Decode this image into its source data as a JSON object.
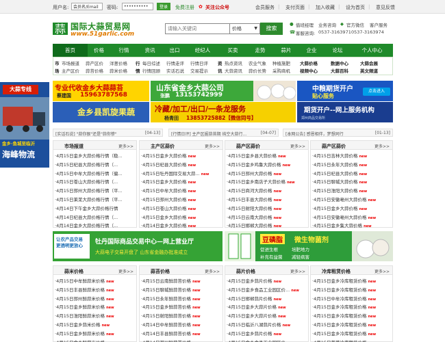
{
  "topbar": {
    "username_label": "用户名:",
    "username_value": "会员名/Email",
    "password_label": "密码:",
    "password_value": "••••••••••",
    "login_button": "登录",
    "register_link": "免费注册",
    "follow_link": "关注公众号",
    "links": [
      "会员服务",
      "支付页面",
      "加入收藏",
      "设为首页",
      "意见反馈"
    ]
  },
  "header": {
    "logo_title": "国际大蒜贸易网",
    "logo_url": "www.51garlic.com",
    "search_placeholder": "请输入关键词",
    "search_select": "价格",
    "search_button": "搜索",
    "contact": {
      "manager": "值班经理",
      "biz": "业务咨询",
      "wechat": "官方微信",
      "cs": "客户服务",
      "hotline": "客服咨询:",
      "phone1": "0537-3163971",
      "phone2": "0537-3163974"
    }
  },
  "nav": [
    "首页",
    "价格",
    "行情",
    "资讯",
    "出口",
    "经纪人",
    "买卖",
    "走势",
    "蒜片",
    "企业",
    "论坛",
    "个人中心"
  ],
  "subnav": {
    "row1": [
      {
        "t": "市",
        "b": true
      },
      "市场报道",
      "蒜产区价",
      "洋葱价格",
      {
        "t": "行",
        "b": true
      },
      "每日综述",
      "行情走评",
      "行情日评",
      {
        "t": "资",
        "b": true
      },
      "热点资讯",
      "农业气象",
      "种植施肥",
      {
        "t": "大蒜价格",
        "b": true
      },
      {
        "t": "数据中心",
        "b": true
      },
      {
        "t": "大蒜会展",
        "b": true
      }
    ],
    "row2": [
      {
        "t": "场",
        "b": true
      },
      "主产区价",
      "蒜苔价格",
      "蒜米价格",
      {
        "t": "情",
        "b": true
      },
      "行情回顾",
      "实话石说",
      "交易提示",
      {
        "t": "讯",
        "b": true
      },
      "大蒜资讯",
      "蒜价长势",
      "采购商机",
      {
        "t": "视频中心",
        "b": true
      },
      {
        "t": "大蒜百科",
        "b": true
      },
      {
        "t": "英文频道",
        "b": true
      }
    ]
  },
  "banners": {
    "b1_line1": "专业代收金乡大蒜蒜苔",
    "b1_name": "蔡建国",
    "b1_phone": "15963787568",
    "b1_line2": "金乡县凯旋果蔬",
    "b2_line1": "山东省金乡大蒜公司",
    "b2_name": "张鹏",
    "b2_phone": "13153742999",
    "b2_line2": "冷藏/加工/出口/一条龙服务",
    "b2_name2": "杨青田",
    "b2_phone2": "13853725882【微信同号】",
    "b3_title": "中粮期货开户",
    "b3_sub": "贴心服务",
    "b3_btn": "点击进入",
    "b4_title": "期货开户--网上服务机构",
    "b4_sub": "郑州商品交易所",
    "float_title": "大蒜专线",
    "float_sub": "金乡·鱼城至临沂",
    "float_brand": "海峰物流",
    "mid1_left": "让农产品交易 更透明更放心",
    "mid1_main": "牡丹国际商品交易中心—网上营业厅",
    "mid1_sub": "大蒜电子交易开盘了 山东省金融办批准成立",
    "mid2_title": "豆磷脂",
    "mid2_title2": "微生物菌剂",
    "mid2_items": [
      "促进生根",
      "培肥地力",
      "补充有益菌",
      "减轻病害"
    ]
  },
  "notices": [
    {
      "text": "[实话石说] \"蒜你狠\"还是\"蒜你惨\"",
      "date": "[04-13]"
    },
    {
      "text": "[行情日评] 主产区掘蒜苔期 纯空大蒜行...",
      "date": "[04-07]"
    },
    {
      "text": "[本网公告] 感恩相伴，梦想同行",
      "date": "[01-13]"
    }
  ],
  "columns1": [
    {
      "title": "市场报道",
      "more": "更多>>",
      "rows": [
        "4月15日金乡大蒜价格行情（稳...",
        "4月15日杞县大蒜价格行情（...",
        "4月15日中牟大蒜价格行情（偏...",
        "4月15日苍山大蒜价格行情（...",
        "4月15日邳州大蒜价格行情（平...",
        "4月15日莱芜大蒜价格行情（平...",
        "4月14日下午金乡大蒜价格行情",
        "4月14日杞县大蒜价格行情（...",
        "4月14日金乡大蒜价格行情（..."
      ]
    },
    {
      "title": "主产区蒜价",
      "more": "更多>>",
      "rows": [
        "4月15日金乡大蒜价格",
        "4月15日杞县大蒜价格",
        "4月15日牡丹国际交易大蒜...",
        "4月15日金乡大蒜价格",
        "4月15日中牟大蒜价格",
        "4月15日邳州大蒜价格",
        "4月15日苍山大蒜价格",
        "4月15日金乡大蒜价格",
        "4月14日金乡大蒜价格"
      ]
    },
    {
      "title": "蒜产区蒜价",
      "more": "更多>>",
      "rows": [
        "4月15日金乡县大蒜价格",
        "4月15日金乡鸡鲁大蒜价格",
        "4月15日邳州大蒜价格",
        "4月15日金乡南店子大蒜价格",
        "4月15日商河大蒜价格",
        "4月15日丰县大蒜价格",
        "4月15日射阳大蒜价格",
        "4月15日云南大蒜价格",
        "4月15日邯郸大蒜价格"
      ]
    },
    {
      "title": "蒜产区蒜价",
      "more": "更多>>",
      "rows": [
        "4月15日吉林大蒜价格",
        "4月15日永年大蒜价格",
        "4月15日杞县大蒜价格",
        "4月15日聊城大蒜价格",
        "4月15日淮阳大蒜价格",
        "4月15日安徽亳州大蒜价格",
        "4月15日金乡大蒜价格",
        "4月15日安徽亳州大蒜价格",
        "4月15日金乡集大蒜价格"
      ]
    }
  ],
  "columns2": [
    {
      "title": "蒜米价格",
      "more": "更多>>",
      "rows": [
        "4月15日中牟鲜蒜米价格",
        "4月15日丰县鲜蒜米价格",
        "4月15日邳州鲜蒜米价格",
        "4月15日金乡鲜蒜米价格",
        "4月15日淮阳鲜蒜米价格",
        "4月15日金乡蒜米价格",
        "4月15日金乡鲜蒜米价格",
        "4月15日金乡鲜蒜米价格",
        "4月15日苍山鲜蒜米价格"
      ]
    },
    {
      "title": "蒜苔价格",
      "more": "更多>>",
      "rows": [
        "4月15日云南鲜蒜苔价格",
        "4月15日聊城鲜蒜苔价格",
        "4月15日永年鲜蒜苔价格",
        "4月15日金乡鲜蒜苔价格",
        "4月15日射阳鲜蒜苔价格",
        "4月14日中牟鲜蒜苔价格",
        "4月14日丰县鲜蒜苔价格",
        "4月14日邳州鲜蒜苔价格",
        "4月14日金乡鲜蒜苔价格"
      ]
    },
    {
      "title": "蒜片价格",
      "more": "更多>>",
      "rows": [
        "4月15日金乡蒜片价格",
        "4月15日金乡食品工业园区价...",
        "4月15日邯郸蒜片价格",
        "4月15日金乡大蒜片价格",
        "4月15日金乡大蒜片价格",
        "4月15日临沂八湖蒜片价格",
        "4月15日金乡蒜片价格",
        "4月15日金乡食品工业园区价...",
        "4月15日金乡蒜片价格"
      ]
    },
    {
      "title": "冷库租赁价格",
      "more": "更多>>",
      "rows": [
        "4月15日金乡冷库租赁价格",
        "4月15日金乡冷库租赁价格",
        "4月15日中牟冷库租赁价格",
        "4月15日金乡冷库租赁价格",
        "4月15日金乡冷库租赁价格",
        "4月15日金乡冷库租赁价格",
        "4月15日金乡冷库租赁价格",
        "4月15日莱芜冷库租赁价格",
        "4月15日金乡冷库租赁价格"
      ]
    }
  ],
  "new_badge": "new"
}
